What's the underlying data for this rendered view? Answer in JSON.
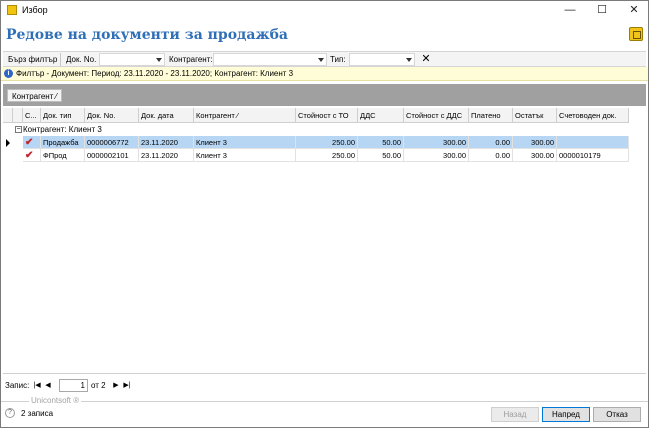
{
  "window": {
    "title": "Избор",
    "minimize_label": "—",
    "maximize_label": "☐",
    "close_label": "✕"
  },
  "header": {
    "title": "Редове на документи за продажба"
  },
  "quick_filter": {
    "button_label": "Бърз филтър",
    "doc_no_label": "Док. No.",
    "doc_no_value": "",
    "contragent_label": "Контрагент:",
    "contragent_value": "",
    "type_label": "Тип:",
    "type_value": "",
    "clear_label": "✕"
  },
  "info": {
    "icon": "i",
    "text": "Филтър - Документ: Период: 23.11.2020 - 23.11.2020; Контрагент: Клиент 3"
  },
  "group_panel": {
    "chip": "Контрагент ⁄"
  },
  "grid": {
    "columns": [
      "С...",
      "Док. тип",
      "Док. No.",
      "Док. дата",
      "Контрагент ⁄",
      "Стойност с ТО",
      "ДДС",
      "Стойност с ДДС",
      "Платено",
      "Остатък",
      "Счетоводен док."
    ],
    "group_row": {
      "expander": "−",
      "label": "Контрагент: Клиент 3"
    },
    "rows": [
      {
        "check": "✔",
        "type": "Продажба",
        "doc_no": "0000006772",
        "date": "23.11.2020",
        "contragent": "Клиент 3",
        "value": "250.00",
        "vat": "50.00",
        "value_vat": "300.00",
        "paid": "0.00",
        "rest": "300.00",
        "acc_doc": ""
      },
      {
        "check": "✔",
        "type": "ФПрод",
        "doc_no": "0000002101",
        "date": "23.11.2020",
        "contragent": "Клиент 3",
        "value": "250.00",
        "vat": "50.00",
        "value_vat": "300.00",
        "paid": "0.00",
        "rest": "300.00",
        "acc_doc": "0000010179"
      }
    ]
  },
  "pager": {
    "label": "Запис:",
    "first": "|◀",
    "prev": "◀",
    "current": "1",
    "of": "от 2",
    "next": "▶",
    "last": "▶|"
  },
  "footer": {
    "brand": "Unicontsoft ®",
    "help": "?",
    "record_count": "2 записа",
    "back_label": "Назад",
    "next_label": "Напред",
    "cancel_label": "Отказ"
  }
}
